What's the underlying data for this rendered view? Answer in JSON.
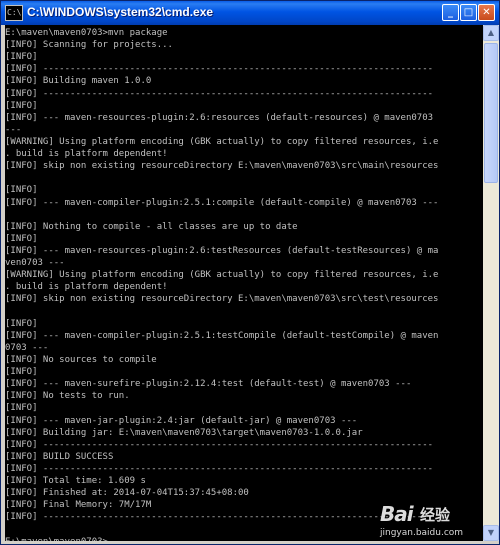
{
  "window": {
    "icon_text": "C:\\",
    "title": "C:\\WINDOWS\\system32\\cmd.exe",
    "minimize_label": "_",
    "maximize_label": "□",
    "close_label": "✕"
  },
  "console": {
    "lines": [
      "E:\\maven\\maven0703>mvn package",
      "[INFO] Scanning for projects...",
      "[INFO]",
      "[INFO] ------------------------------------------------------------------------",
      "[INFO] Building maven 1.0.0",
      "[INFO] ------------------------------------------------------------------------",
      "[INFO]",
      "[INFO] --- maven-resources-plugin:2.6:resources (default-resources) @ maven0703",
      "---",
      "[WARNING] Using platform encoding (GBK actually) to copy filtered resources, i.e",
      ". build is platform dependent!",
      "[INFO] skip non existing resourceDirectory E:\\maven\\maven0703\\src\\main\\resources",
      "",
      "[INFO]",
      "[INFO] --- maven-compiler-plugin:2.5.1:compile (default-compile) @ maven0703 ---",
      "",
      "[INFO] Nothing to compile - all classes are up to date",
      "[INFO]",
      "[INFO] --- maven-resources-plugin:2.6:testResources (default-testResources) @ ma",
      "ven0703 ---",
      "[WARNING] Using platform encoding (GBK actually) to copy filtered resources, i.e",
      ". build is platform dependent!",
      "[INFO] skip non existing resourceDirectory E:\\maven\\maven0703\\src\\test\\resources",
      "",
      "[INFO]",
      "[INFO] --- maven-compiler-plugin:2.5.1:testCompile (default-testCompile) @ maven",
      "0703 ---",
      "[INFO] No sources to compile",
      "[INFO]",
      "[INFO] --- maven-surefire-plugin:2.12.4:test (default-test) @ maven0703 ---",
      "[INFO] No tests to run.",
      "[INFO]",
      "[INFO] --- maven-jar-plugin:2.4:jar (default-jar) @ maven0703 ---",
      "[INFO] Building jar: E:\\maven\\maven0703\\target\\maven0703-1.0.0.jar",
      "[INFO] ------------------------------------------------------------------------",
      "[INFO] BUILD SUCCESS",
      "[INFO] ------------------------------------------------------------------------",
      "[INFO] Total time: 1.609 s",
      "[INFO] Finished at: 2014-07-04T15:37:45+08:00",
      "[INFO] Final Memory: 7M/17M",
      "[INFO] ------------------------------------------------------------------------",
      "",
      "E:\\maven\\maven0703>"
    ]
  },
  "watermark": {
    "logo": "Bai",
    "brand": "经验",
    "url": "jingyan.baidu.com"
  },
  "colors": {
    "console_background": "#000000",
    "console_text": "#c0c0c0",
    "titlebar": "#0054e3"
  }
}
